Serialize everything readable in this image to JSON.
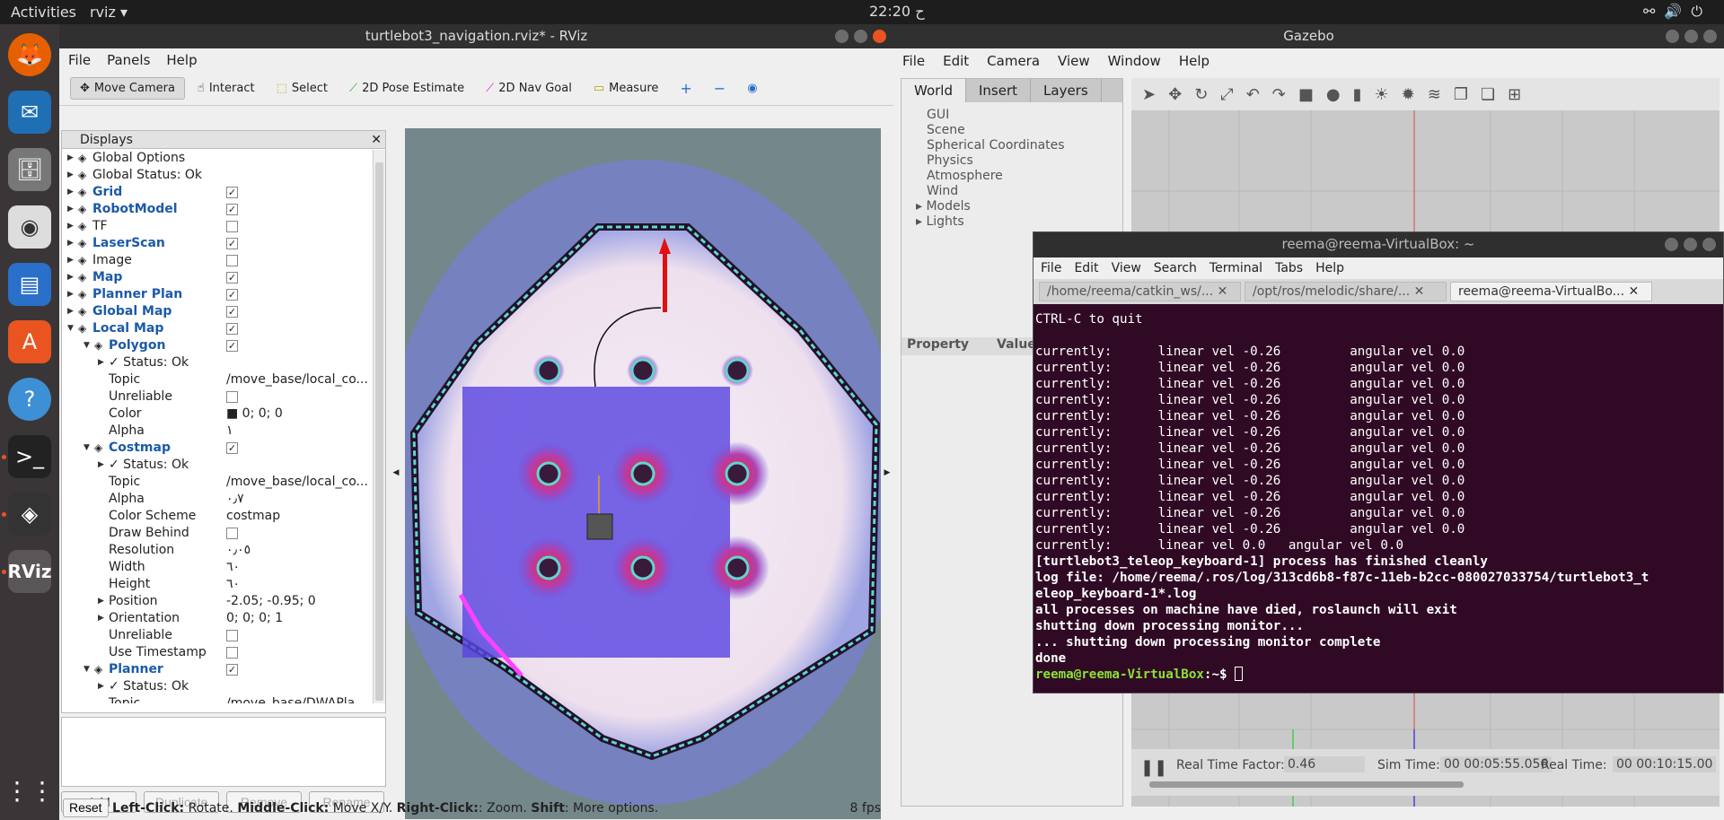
{
  "topbar": {
    "activities": "Activities",
    "app": "rviz ▾",
    "clock": "22:20 ح"
  },
  "rviz": {
    "title": "turtlebot3_navigation.rviz* - RViz",
    "menu": [
      "File",
      "Panels",
      "Help"
    ],
    "tools": [
      "Move Camera",
      "Interact",
      "Select",
      "2D Pose Estimate",
      "2D Nav Goal",
      "Measure"
    ],
    "displays_title": "Displays",
    "rows": [
      {
        "name": "Global Options",
        "ind": 1,
        "tri": "▶"
      },
      {
        "name": "Global Status: Ok",
        "ind": 1,
        "tri": "▶"
      },
      {
        "name": "Grid",
        "ind": 1,
        "tri": "▶",
        "blue": true,
        "cb": "✓"
      },
      {
        "name": "RobotModel",
        "ind": 1,
        "tri": "▶",
        "blue": true,
        "cb": "✓"
      },
      {
        "name": "TF",
        "ind": 1,
        "tri": "▶",
        "cb": ""
      },
      {
        "name": "LaserScan",
        "ind": 1,
        "tri": "▶",
        "blue": true,
        "cb": "✓"
      },
      {
        "name": "Image",
        "ind": 1,
        "tri": "▶",
        "cb": ""
      },
      {
        "name": "Map",
        "ind": 1,
        "tri": "▶",
        "blue": true,
        "cb": "✓"
      },
      {
        "name": "Planner Plan",
        "ind": 1,
        "tri": "▶",
        "blue": true,
        "cb": "✓"
      },
      {
        "name": "Global Map",
        "ind": 1,
        "tri": "▶",
        "blue": true,
        "cb": "✓"
      },
      {
        "name": "Local Map",
        "ind": 1,
        "tri": "▼",
        "blue": true,
        "cb": "✓"
      },
      {
        "name": "Polygon",
        "ind": 2,
        "tri": "▼",
        "blue": true,
        "cb": "✓"
      },
      {
        "name": "✓ Status: Ok",
        "ind": 3,
        "tri": "▶"
      },
      {
        "name": "Topic",
        "ind": 3,
        "val": "/move_base/local_co..."
      },
      {
        "name": "Unreliable",
        "ind": 3,
        "cb": ""
      },
      {
        "name": "Color",
        "ind": 3,
        "val": "■ 0; 0; 0"
      },
      {
        "name": "Alpha",
        "ind": 3,
        "val": "١"
      },
      {
        "name": "Costmap",
        "ind": 2,
        "tri": "▼",
        "blue": true,
        "cb": "✓"
      },
      {
        "name": "✓ Status: Ok",
        "ind": 3,
        "tri": "▶"
      },
      {
        "name": "Topic",
        "ind": 3,
        "val": "/move_base/local_co..."
      },
      {
        "name": "Alpha",
        "ind": 3,
        "val": "٠٫٧"
      },
      {
        "name": "Color Scheme",
        "ind": 3,
        "val": "costmap"
      },
      {
        "name": "Draw Behind",
        "ind": 3,
        "cb": ""
      },
      {
        "name": "Resolution",
        "ind": 3,
        "val": "٠٫٠٥"
      },
      {
        "name": "Width",
        "ind": 3,
        "val": "٦٠"
      },
      {
        "name": "Height",
        "ind": 3,
        "val": "٦٠"
      },
      {
        "name": "Position",
        "ind": 3,
        "tri": "▶",
        "val": "-2.05; -0.95; 0"
      },
      {
        "name": "Orientation",
        "ind": 3,
        "tri": "▶",
        "val": "0; 0; 0; 1"
      },
      {
        "name": "Unreliable",
        "ind": 3,
        "cb": ""
      },
      {
        "name": "Use Timestamp",
        "ind": 3,
        "cb": ""
      },
      {
        "name": "Planner",
        "ind": 2,
        "tri": "▼",
        "blue": true,
        "cb": "✓"
      },
      {
        "name": "✓ Status: Ok",
        "ind": 3,
        "tri": "▶"
      },
      {
        "name": "Topic",
        "ind": 3,
        "val": "/move_base/DWAPla..."
      }
    ],
    "buttons": {
      "add": "Add",
      "duplicate": "Duplicate",
      "remove": "Remove",
      "rename": "Rename"
    },
    "status": {
      "reset": "Reset",
      "lc": "Left-Click:",
      "lc_t": " Rotate. ",
      "mc": "Middle-Click:",
      "mc_t": " Move X/Y. ",
      "rc": "Right-Click:",
      "rc_t": ": Zoom. ",
      "sh": "Shift",
      "sh_t": ": More options.",
      "fps": "8 fps"
    }
  },
  "gazebo": {
    "title": "Gazebo",
    "menu": [
      "File",
      "Edit",
      "Camera",
      "View",
      "Window",
      "Help"
    ],
    "tabs": [
      "World",
      "Insert",
      "Layers"
    ],
    "tree": [
      "GUI",
      "Scene",
      "Spherical Coordinates",
      "Physics",
      "Atmosphere",
      "Wind",
      "▸ Models",
      "▸ Lights"
    ],
    "prop": "Property",
    "value": "Value",
    "rtf_label": "Real Time Factor:",
    "rtf": "0.46",
    "sim_label": "Sim Time:",
    "sim": "00 00:05:55.056",
    "real_label": "Real Time:",
    "real": "00 00:10:15.00"
  },
  "terminal": {
    "title": "reema@reema-VirtualBox: ~",
    "menu": [
      "File",
      "Edit",
      "View",
      "Search",
      "Terminal",
      "Tabs",
      "Help"
    ],
    "tabs": [
      "/home/reema/catkin_ws/...",
      "/opt/ros/melodic/share/...",
      "reema@reema-VirtualBo..."
    ],
    "lines": [
      "CTRL-C to quit",
      "",
      "currently:      linear vel -0.26         angular vel 0.0",
      "currently:      linear vel -0.26         angular vel 0.0",
      "currently:      linear vel -0.26         angular vel 0.0",
      "currently:      linear vel -0.26         angular vel 0.0",
      "currently:      linear vel -0.26         angular vel 0.0",
      "currently:      linear vel -0.26         angular vel 0.0",
      "currently:      linear vel -0.26         angular vel 0.0",
      "currently:      linear vel -0.26         angular vel 0.0",
      "currently:      linear vel -0.26         angular vel 0.0",
      "currently:      linear vel -0.26         angular vel 0.0",
      "currently:      linear vel -0.26         angular vel 0.0",
      "currently:      linear vel -0.26         angular vel 0.0",
      "currently:      linear vel 0.0   angular vel 0.0"
    ],
    "bold_lines": [
      "[turtlebot3_teleop_keyboard-1] process has finished cleanly",
      "log file: /home/reema/.ros/log/313cd6b8-f87c-11eb-b2cc-080027033754/turtlebot3_t",
      "eleop_keyboard-1*.log",
      "all processes on machine have died, roslaunch will exit",
      "shutting down processing monitor...",
      "... shutting down processing monitor complete",
      "done"
    ],
    "prompt": "reema@reema-VirtualBox",
    "prompt_tail": ":~$ "
  }
}
